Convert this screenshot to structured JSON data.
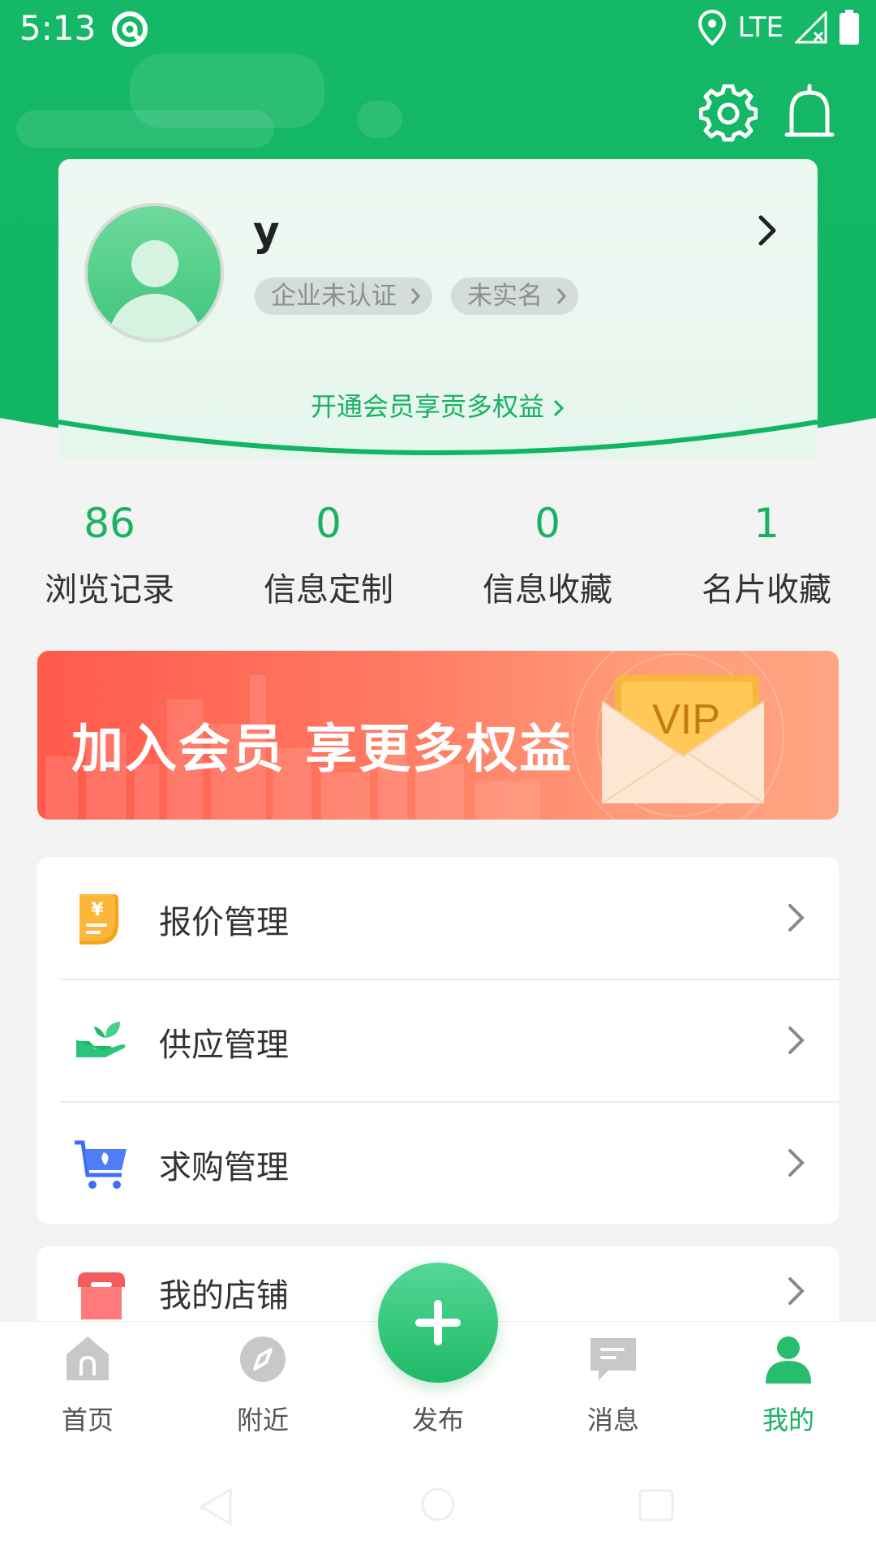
{
  "status_bar": {
    "time": "5:13",
    "network": "LTE"
  },
  "profile": {
    "name": "y",
    "tag_company": "企业未认证",
    "tag_realname": "未实名",
    "vip_link": "开通会员享贡多权益"
  },
  "stats": [
    {
      "value": "86",
      "label": "浏览记录"
    },
    {
      "value": "0",
      "label": "信息定制"
    },
    {
      "value": "0",
      "label": "信息收藏"
    },
    {
      "value": "1",
      "label": "名片收藏"
    }
  ],
  "banner": {
    "title": "加入会员  享更多权益",
    "badge": "VIP"
  },
  "menu": [
    {
      "label": "报价管理",
      "icon": "quote-icon"
    },
    {
      "label": "供应管理",
      "icon": "supply-icon"
    },
    {
      "label": "求购管理",
      "icon": "cart-icon"
    },
    {
      "label": "我的店铺",
      "icon": "shop-icon"
    }
  ],
  "bottom_nav": [
    {
      "label": "首页",
      "icon": "home-icon"
    },
    {
      "label": "附近",
      "icon": "compass-icon"
    },
    {
      "label": "发布",
      "icon": "plus-icon"
    },
    {
      "label": "消息",
      "icon": "message-icon"
    },
    {
      "label": "我的",
      "icon": "user-icon"
    }
  ],
  "colors": {
    "brand_green": "#19b263",
    "banner_red": "#ff5a4c",
    "page_bg": "#f2f3f2"
  }
}
